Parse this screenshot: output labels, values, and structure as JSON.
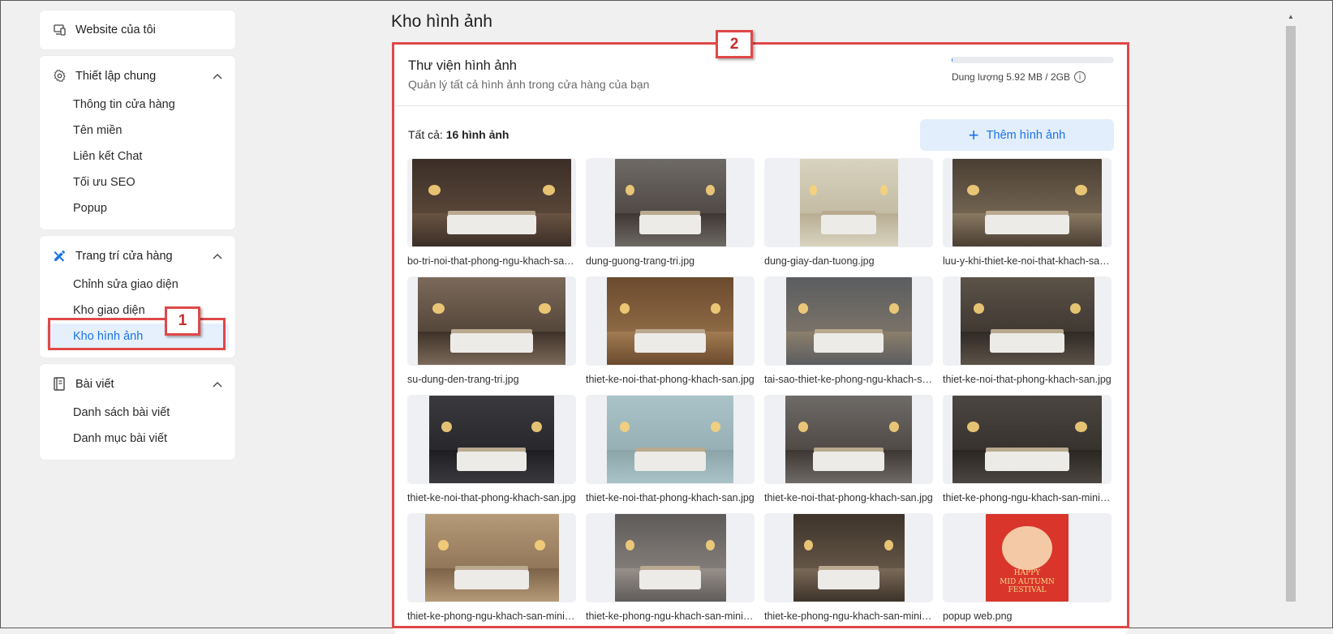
{
  "sidebar": {
    "my_website": "Website của tôi",
    "general": {
      "title": "Thiết lập chung",
      "items": [
        "Thông tin cửa hàng",
        "Tên miền",
        "Liên kết Chat",
        "Tối ưu SEO",
        "Popup"
      ]
    },
    "decorate": {
      "title": "Trang trí cửa hàng",
      "items": [
        "Chỉnh sửa giao diện",
        "Kho giao diện",
        "Kho hình ảnh"
      ],
      "active_item": "Kho hình ảnh"
    },
    "posts": {
      "title": "Bài viết",
      "items": [
        "Danh sách bài viết",
        "Danh mục bài viết"
      ]
    }
  },
  "page": {
    "title": "Kho hình ảnh"
  },
  "library": {
    "title": "Thư viện hình ảnh",
    "subtitle": "Quản lý tất cả hình ảnh trong cửa hàng của bạn",
    "storage_text": "Dung lượng 5.92 MB / 2GB",
    "storage_used_fraction": 0.003,
    "count_label": "Tất cả:",
    "count_value": "16 hình ảnh",
    "add_button": "Thêm hình ảnh",
    "images": [
      "bo-tri-noi-that-phong-ngu-khach-san.jpg",
      "dung-guong-trang-tri.jpg",
      "dung-giay-dan-tuong.jpg",
      "luu-y-khi-thiet-ke-noi-that-khach-san.jpg",
      "su-dung-den-trang-tri.jpg",
      "thiet-ke-noi-that-phong-khach-san.jpg",
      "tai-sao-thiet-ke-phong-ngu-khach-san.jpg",
      "thiet-ke-noi-that-phong-khach-san.jpg",
      "thiet-ke-noi-that-phong-khach-san.jpg",
      "thiet-ke-noi-that-phong-khach-san.jpg",
      "thiet-ke-noi-that-phong-khach-san.jpg",
      "thiet-ke-phong-ngu-khach-san-mini.jpg",
      "thiet-ke-phong-ngu-khach-san-mini.jpg",
      "thiet-ke-phong-ngu-khach-san-mini.jpg",
      "thiet-ke-phong-ngu-khach-san-mini.jpg",
      "popup web.png"
    ],
    "popup_art_text": [
      "HAPPY",
      "MID AUTUMN",
      "FESTIVAL"
    ]
  },
  "annotations": {
    "badge1": "1",
    "badge2": "2",
    "color": "#e04848"
  },
  "colors": {
    "accent": "#1a73e8",
    "active_bg": "#e6f0fc",
    "button_bg": "#e2eefc"
  }
}
